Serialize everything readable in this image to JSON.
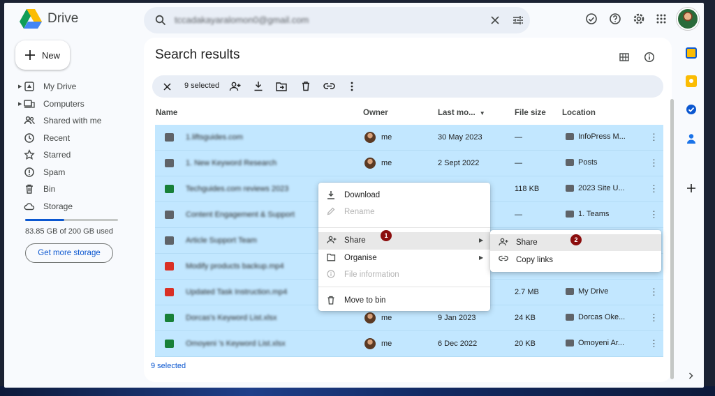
{
  "app": {
    "name": "Drive"
  },
  "search": {
    "query": "tccadakayaralomon0@gmail.com"
  },
  "nav": {
    "new_label": "New",
    "items": [
      {
        "label": "My Drive"
      },
      {
        "label": "Computers"
      },
      {
        "label": "Shared with me"
      },
      {
        "label": "Recent"
      },
      {
        "label": "Starred"
      },
      {
        "label": "Spam"
      },
      {
        "label": "Bin"
      },
      {
        "label": "Storage"
      }
    ],
    "storage_used": "83.85 GB of 200 GB used",
    "storage_fraction": 0.42,
    "get_more_label": "Get more storage"
  },
  "main": {
    "title": "Search results",
    "selection_count": "9 selected",
    "footer_selected": "9 selected",
    "columns": {
      "name": "Name",
      "owner": "Owner",
      "modified": "Last mo...",
      "size": "File size",
      "location": "Location"
    },
    "rows": [
      {
        "name": "1.liftsguides.com",
        "owner": "me",
        "modified": "30 May 2023",
        "size": "—",
        "location": "InfoPress M..."
      },
      {
        "name": "1. New Keyword Research",
        "owner": "me",
        "modified": "2 Sept 2022",
        "size": "—",
        "location": "Posts"
      },
      {
        "name": "Techguides.com reviews 2023",
        "owner": "",
        "modified": "",
        "size": "118 KB",
        "location": "2023 Site U..."
      },
      {
        "name": "Content Engagement & Support",
        "owner": "",
        "modified": "",
        "size": "—",
        "location": "1. Teams"
      },
      {
        "name": "Article Support Team",
        "owner": "",
        "modified": "",
        "size": "",
        "location": ""
      },
      {
        "name": "Modify products backup.mp4",
        "owner": "",
        "modified": "",
        "size": "",
        "location": ""
      },
      {
        "name": "Updated Task Instruction.mp4",
        "owner": "",
        "modified": "",
        "size": "2.7 MB",
        "location": "My Drive"
      },
      {
        "name": "Dorcas's Keyword List.xlsx",
        "owner": "me",
        "modified": "9 Jan 2023",
        "size": "24 KB",
        "location": "Dorcas Oke..."
      },
      {
        "name": "Omoyeni 's Keyword List.xlsx",
        "owner": "me",
        "modified": "6 Dec 2022",
        "size": "20 KB",
        "location": "Omoyeni Ar..."
      }
    ]
  },
  "context_menu": {
    "download": "Download",
    "rename": "Rename",
    "share": "Share",
    "organise": "Organise",
    "file_information": "File information",
    "move_to_bin": "Move to bin"
  },
  "submenu": {
    "share": "Share",
    "copy_links": "Copy links"
  },
  "badges": {
    "first": "1",
    "second": "2"
  },
  "colors": {
    "accent": "#0b57d0",
    "selected_row": "#c2e7ff",
    "badge": "#8b0d0d"
  }
}
